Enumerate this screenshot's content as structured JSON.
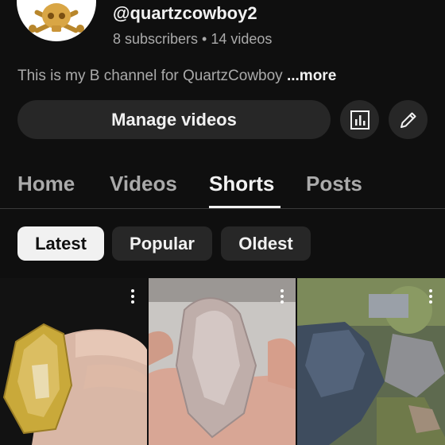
{
  "channel": {
    "avatar_icon": "skull-crossbones-logo",
    "handle": "@quartzcowboy2",
    "meta": "8 subscribers • 14 videos",
    "description": "This is my B channel for QuartzCowboy ",
    "more_label": "...more"
  },
  "actions": {
    "manage_label": "Manage videos",
    "analytics_icon": "analytics-icon",
    "edit_icon": "pencil-icon"
  },
  "tabs": [
    {
      "label": "Home",
      "active": false
    },
    {
      "label": "Videos",
      "active": false
    },
    {
      "label": "Shorts",
      "active": true
    },
    {
      "label": "Posts",
      "active": false
    }
  ],
  "chips": [
    {
      "label": "Latest",
      "active": true
    },
    {
      "label": "Popular",
      "active": false
    },
    {
      "label": "Oldest",
      "active": false
    }
  ],
  "shorts": [
    {
      "thumbnail": "yellow-quartz-crystal-in-hand",
      "menu_icon": "more-vert-icon"
    },
    {
      "thumbnail": "clear-quartz-crystal-in-hand",
      "menu_icon": "more-vert-icon"
    },
    {
      "thumbnail": "gloved-hand-digging-rocks",
      "menu_icon": "more-vert-icon"
    }
  ],
  "colors": {
    "background": "#0f0f0f",
    "surface": "#272727",
    "text_primary": "#f1f1f1",
    "text_secondary": "#aaaaaa"
  }
}
